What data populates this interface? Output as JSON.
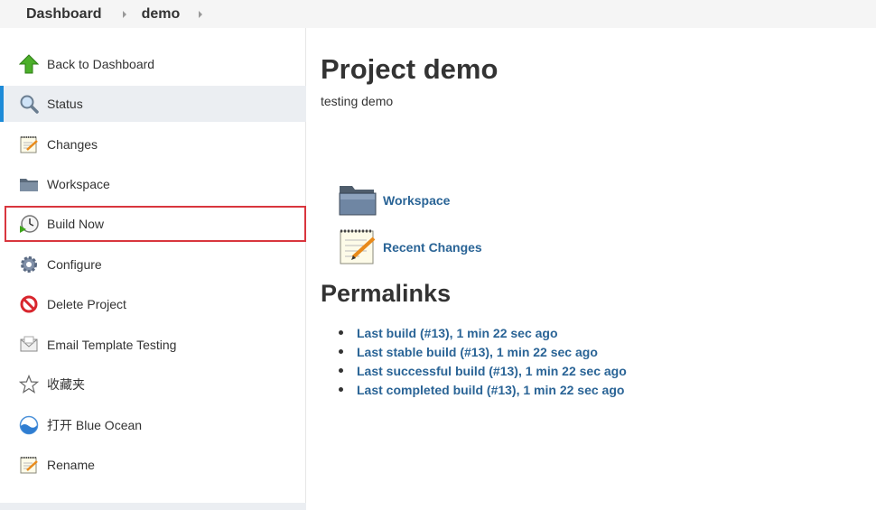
{
  "breadcrumb": {
    "items": [
      "Dashboard",
      "demo"
    ]
  },
  "sidebar": {
    "items": [
      {
        "label": "Back to Dashboard",
        "icon": "up-arrow-icon"
      },
      {
        "label": "Status",
        "icon": "magnifier-icon",
        "active": true
      },
      {
        "label": "Changes",
        "icon": "notepad-icon"
      },
      {
        "label": "Workspace",
        "icon": "folder-icon"
      },
      {
        "label": "Build Now",
        "icon": "clock-icon",
        "highlighted": true
      },
      {
        "label": "Configure",
        "icon": "gear-icon"
      },
      {
        "label": "Delete Project",
        "icon": "no-entry-icon"
      },
      {
        "label": "Email Template Testing",
        "icon": "envelope-icon"
      },
      {
        "label": "收藏夹",
        "icon": "star-icon"
      },
      {
        "label": "打开 Blue Ocean",
        "icon": "blue-ocean-icon"
      },
      {
        "label": "Rename",
        "icon": "notepad-icon"
      }
    ]
  },
  "main": {
    "title": "Project demo",
    "description": "testing demo",
    "links": [
      {
        "label": "Workspace",
        "icon": "folder-icon"
      },
      {
        "label": "Recent Changes",
        "icon": "notepad-icon"
      }
    ],
    "permalinks_heading": "Permalinks",
    "permalinks": [
      "Last build (#13), 1 min 22 sec ago",
      "Last stable build (#13), 1 min 22 sec ago",
      "Last successful build (#13), 1 min 22 sec ago",
      "Last completed build (#13), 1 min 22 sec ago"
    ]
  },
  "colors": {
    "link": "#2a6496",
    "active_border": "#1d8bd8",
    "highlight_border": "#d9363e",
    "active_bg": "#ebeef2",
    "breadcrumb_bg": "#f5f5f5"
  }
}
